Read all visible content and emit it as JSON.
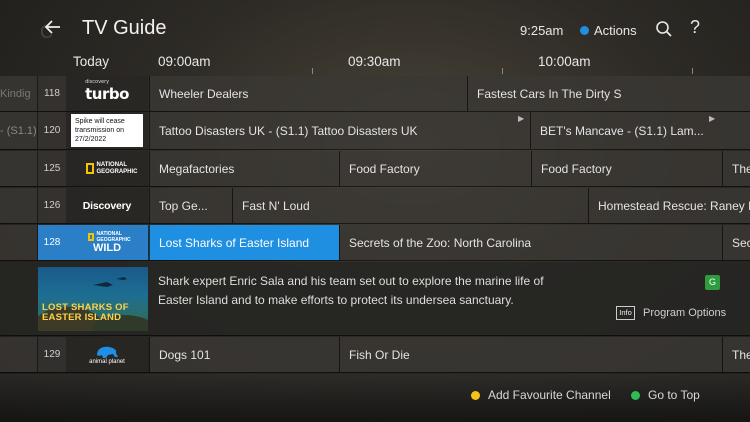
{
  "header": {
    "ghost_text": "C",
    "title": "TV Guide",
    "clock": "9:25am",
    "actions_label": "Actions",
    "actions_color": "#1e8fe1"
  },
  "timeline": {
    "day": "Today",
    "slots": [
      "09:00am",
      "09:30am",
      "10:00am"
    ]
  },
  "rows": [
    {
      "left_text": "Kindig",
      "number": "118",
      "logo": "turbo",
      "logo_text": "turbo",
      "logo_small": "discovery",
      "programs": [
        {
          "title": "Wheeler Dealers",
          "arrow": false
        },
        {
          "title": "Fastest Cars In The Dirty S",
          "arrow": false
        }
      ]
    },
    {
      "left_text": "- (S1.1)",
      "number": "120",
      "logo": "notice",
      "logo_text": "Spike will cease transmission on 27/2/2022",
      "programs": [
        {
          "title": "Tattoo Disasters UK - (S1.1) Tattoo Disasters UK",
          "arrow": true
        },
        {
          "title": "BET's Mancave - (S1.1) Lam...",
          "arrow": true
        }
      ]
    },
    {
      "left_text": "",
      "number": "125",
      "logo": "natgeo",
      "logo_text": "NATIONAL GEOGRAPHIC",
      "programs": [
        {
          "title": "Megafactories",
          "arrow": false
        },
        {
          "title": "Food Factory",
          "arrow": false
        },
        {
          "title": "Food Factory",
          "arrow": false
        },
        {
          "title": "The",
          "arrow": false
        }
      ]
    },
    {
      "left_text": "",
      "number": "126",
      "logo": "discovery",
      "logo_text": "Discovery",
      "programs": [
        {
          "title": "Top Ge...",
          "arrow": false
        },
        {
          "title": "Fast N' Loud",
          "arrow": false
        },
        {
          "title": "Homestead Rescue: Raney R",
          "arrow": false
        }
      ]
    },
    {
      "left_text": "",
      "number": "128",
      "logo": "natgeo-wild",
      "logo_text": "WILD",
      "logo_small": "NATIONAL GEOGRAPHIC",
      "selected": true,
      "programs": [
        {
          "title": "Lost Sharks of Easter Island",
          "arrow": false,
          "selected": true
        },
        {
          "title": "Secrets of the Zoo: North Carolina",
          "arrow": false
        },
        {
          "title": "Sec",
          "arrow": false
        }
      ]
    },
    {
      "left_text": "",
      "number": "129",
      "logo": "animal-planet",
      "logo_text": "animal planet",
      "programs": [
        {
          "title": "Dogs 101",
          "arrow": false
        },
        {
          "title": "Fish Or Die",
          "arrow": false
        },
        {
          "title": "The",
          "arrow": false
        }
      ]
    }
  ],
  "detail": {
    "thumb_title": "LOST SHARKS OF EASTER ISLAND",
    "description": "Shark expert Enric Sala and his team set out to explore the marine life of Easter Island and to make efforts to protect its undersea sanctuary.",
    "rating_badge": "G",
    "info_label": "Info",
    "program_options": "Program Options"
  },
  "footer": {
    "add_favourite": {
      "label": "Add Favourite Channel",
      "color": "#f5c21b"
    },
    "go_top": {
      "label": "Go to Top",
      "color": "#2ebd55"
    }
  }
}
